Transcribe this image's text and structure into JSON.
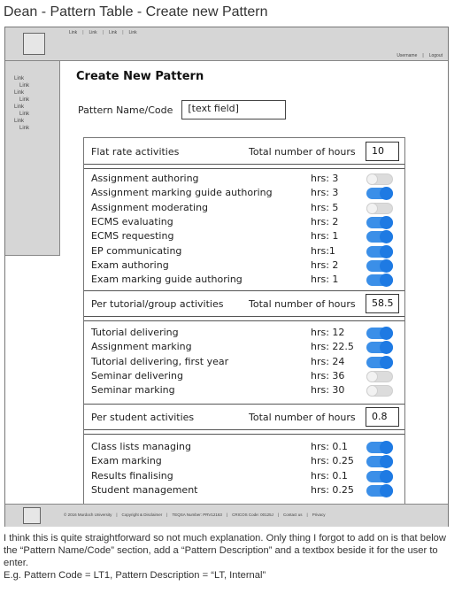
{
  "doc_title": "Dean - Pattern Table - Create new Pattern",
  "header": {
    "links": [
      "Link",
      "Link",
      "Link",
      "Link"
    ],
    "username": "Username",
    "logout": "Logout"
  },
  "sidebar": {
    "links": [
      {
        "label": "Link",
        "level": 0
      },
      {
        "label": "Link",
        "level": 1
      },
      {
        "label": "Link",
        "level": 0
      },
      {
        "label": "Link",
        "level": 1
      },
      {
        "label": "Link",
        "level": 0
      },
      {
        "label": "Link",
        "level": 1
      },
      {
        "label": "Link",
        "level": 0
      },
      {
        "label": "Link",
        "level": 1
      }
    ]
  },
  "form": {
    "heading": "Create New Pattern",
    "name_label": "Pattern Name/Code",
    "name_placeholder": "[text field]"
  },
  "sections": [
    {
      "title": "Flat rate activities",
      "total_label": "Total number of hours",
      "total_value": "10",
      "activities": [
        {
          "name": "Assignment authoring",
          "hrs": "hrs: 3",
          "enabled": false
        },
        {
          "name": "Assignment marking guide authoring",
          "hrs": "hrs: 3",
          "enabled": true
        },
        {
          "name": "Assignment moderating",
          "hrs": "hrs: 5",
          "enabled": false
        },
        {
          "name": "ECMS evaluating",
          "hrs": "hrs: 2",
          "enabled": true
        },
        {
          "name": "ECMS requesting",
          "hrs": "hrs: 1",
          "enabled": true
        },
        {
          "name": "EP communicating",
          "hrs": "hrs:1",
          "enabled": true
        },
        {
          "name": "Exam authoring",
          "hrs": "hrs: 2",
          "enabled": true
        },
        {
          "name": "Exam marking guide authoring",
          "hrs": "hrs: 1",
          "enabled": true
        }
      ]
    },
    {
      "title": "Per tutorial/group activities",
      "total_label": "Total number of hours",
      "total_value": "58.5",
      "activities": [
        {
          "name": "Tutorial delivering",
          "hrs": "hrs: 12",
          "enabled": true
        },
        {
          "name": "Assignment marking",
          "hrs": "hrs: 22.5",
          "enabled": true
        },
        {
          "name": "Tutorial delivering, first year",
          "hrs": "hrs: 24",
          "enabled": true
        },
        {
          "name": "Seminar delivering",
          "hrs": "hrs: 36",
          "enabled": false
        },
        {
          "name": "Seminar marking",
          "hrs": "hrs: 30",
          "enabled": false
        }
      ]
    },
    {
      "title": "Per student activities",
      "total_label": "Total number of hours",
      "total_value": "0.8",
      "activities": [
        {
          "name": "Class lists managing",
          "hrs": "hrs: 0.1",
          "enabled": true
        },
        {
          "name": "Exam marking",
          "hrs": "hrs: 0.25",
          "enabled": true
        },
        {
          "name": "Results finalising",
          "hrs": "hrs: 0.1",
          "enabled": true
        },
        {
          "name": "Student management",
          "hrs": "hrs: 0.25",
          "enabled": true
        }
      ]
    }
  ],
  "footer": {
    "items": [
      "© 2016 Murdoch University",
      "Copyright & Disclaimer",
      "TEQSA Number: PRV12163",
      "CRICOS Code: 00125J",
      "Contact us",
      "Privacy"
    ]
  },
  "note": {
    "line1": "I think this is quite straightforward so not much explanation. Only thing I forgot to add on is that below the “Pattern Name/Code” section, add a “Pattern Description” and a textbox beside it for the user to enter.",
    "line2": "E.g. Pattern Code = LT1, Pattern Description = “LT, Internal”"
  }
}
